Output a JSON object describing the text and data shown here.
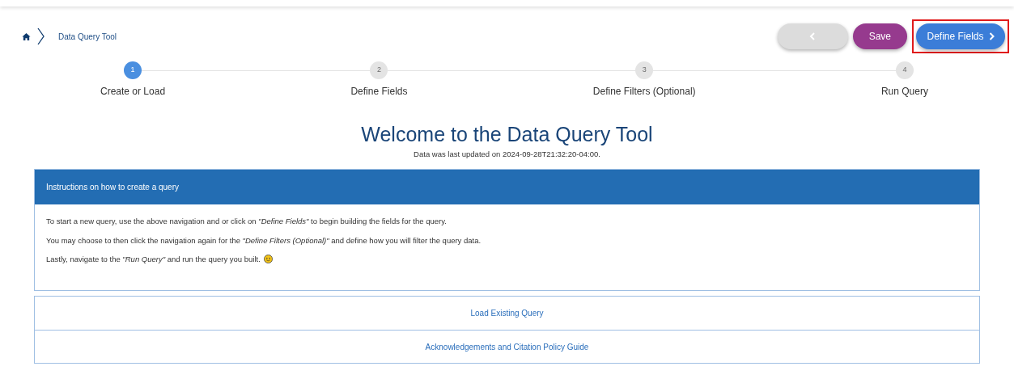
{
  "breadcrumb": {
    "label": "Data Query Tool"
  },
  "toolbar": {
    "back": {
      "disabled": true
    },
    "save": {
      "label": "Save"
    },
    "next": {
      "label": "Define Fields",
      "highlighted": true
    }
  },
  "steps": [
    {
      "number": "1",
      "label": "Create or Load",
      "selected": true
    },
    {
      "number": "2",
      "label": "Define Fields",
      "selected": false
    },
    {
      "number": "3",
      "label": "Define Filters (Optional)",
      "selected": false
    },
    {
      "number": "4",
      "label": "Run Query",
      "selected": false
    }
  ],
  "title": "Welcome to the Data Query Tool",
  "subtitle": "Data was last updated on 2024-09-28T21:32:20-04:00.",
  "instructions": {
    "heading": "Instructions on how to create a query",
    "lines": [
      "To start a new query, use the above navigation and or click on *\"Define Fields\"* to begin building the fields for the query.",
      "You may choose to then click the navigation again for the *\"Define Filters (Optional)\"* and define how you will filter the query data.",
      "Lastly, navigate to the *\"Run Query\"* and run the query you built."
    ]
  },
  "sections": [
    "Load Existing Query",
    "Acknowledgements and Citation Policy Guide"
  ]
}
